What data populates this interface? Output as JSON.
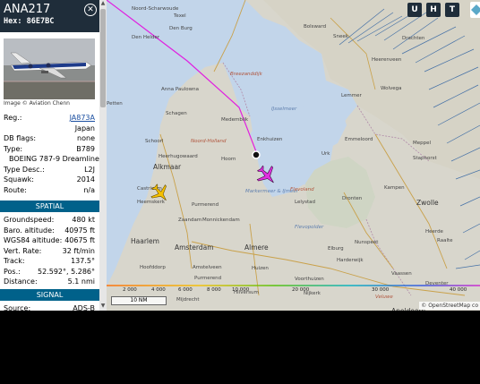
{
  "header": {
    "callsign": "ANA217",
    "hex_label": "Hex:",
    "hex": "86E7BC",
    "close_icon": "close-icon"
  },
  "photo": {
    "credit": "Image © Aviation Chenn"
  },
  "details": [
    {
      "label": "Reg.:",
      "value": "JA873A",
      "link": true
    },
    {
      "label": "",
      "value": "Japan"
    },
    {
      "label": "DB flags:",
      "value": "none"
    },
    {
      "label": "Type:",
      "value": "B789"
    },
    {
      "label": "",
      "value": "BOEING 787-9 Dreamliner",
      "wide": true
    },
    {
      "label": "Type Desc.:",
      "value": "L2J"
    },
    {
      "label": "Squawk:",
      "value": "2014"
    },
    {
      "label": "Route:",
      "value": "n/a"
    }
  ],
  "sections": {
    "spatial": "SPATIAL",
    "signal": "SIGNAL"
  },
  "spatial": [
    {
      "label": "Groundspeed:",
      "value": "480 kt"
    },
    {
      "label": "Baro. altitude:",
      "value": "40975 ft"
    },
    {
      "label": "WGS84 altitude:",
      "value": "40675 ft"
    },
    {
      "label": "Vert. Rate:",
      "value": "32 ft/min"
    },
    {
      "label": "Track:",
      "value": "137.5°"
    },
    {
      "label": "Pos.:",
      "value": "52.592°, 5.286°"
    },
    {
      "label": "Distance:",
      "value": "5.1 nmi"
    }
  ],
  "signal": [
    {
      "label": "Source:",
      "value": "ADS-B"
    }
  ],
  "map": {
    "buttons": [
      "U",
      "H",
      "T"
    ],
    "scale": "10 NM",
    "attribution": "© OpenStreetMap co",
    "altitude_ticks": [
      "2 000",
      "4 000",
      "6 000",
      "8 000",
      "10 000",
      "20 000",
      "30 000",
      "40 000"
    ],
    "places": [
      {
        "name": "Noord-Scharwoude",
        "cls": ""
      },
      {
        "name": "Texel",
        "cls": ""
      },
      {
        "name": "Den Burg",
        "cls": ""
      },
      {
        "name": "Bolsward",
        "cls": ""
      },
      {
        "name": "Sneek",
        "cls": ""
      },
      {
        "name": "Heerenveen",
        "cls": ""
      },
      {
        "name": "Wolvega",
        "cls": ""
      },
      {
        "name": "Lemmer",
        "cls": ""
      },
      {
        "name": "Den Helder",
        "cls": ""
      },
      {
        "name": "Anna Paulowna",
        "cls": ""
      },
      {
        "name": "Schagen",
        "cls": ""
      },
      {
        "name": "Medemblik",
        "cls": ""
      },
      {
        "name": "Breezanddijk",
        "cls": "region"
      },
      {
        "name": "IJsselmeer",
        "cls": "water"
      },
      {
        "name": "Petten",
        "cls": ""
      },
      {
        "name": "Schoorl",
        "cls": ""
      },
      {
        "name": "Noord-Holland",
        "cls": "region"
      },
      {
        "name": "Enkhuizen",
        "cls": ""
      },
      {
        "name": "Emmeloord",
        "cls": ""
      },
      {
        "name": "Meppel",
        "cls": ""
      },
      {
        "name": "Staphorst",
        "cls": ""
      },
      {
        "name": "Heerhugowaard",
        "cls": ""
      },
      {
        "name": "Hoorn",
        "cls": ""
      },
      {
        "name": "Urk",
        "cls": ""
      },
      {
        "name": "Alkmaar",
        "cls": "big"
      },
      {
        "name": "Castricum",
        "cls": ""
      },
      {
        "name": "Heemskerk",
        "cls": ""
      },
      {
        "name": "Markermeer & IJmeer",
        "cls": "water"
      },
      {
        "name": "Lelystad",
        "cls": ""
      },
      {
        "name": "Flevoland",
        "cls": "region"
      },
      {
        "name": "Dronten",
        "cls": ""
      },
      {
        "name": "Kampen",
        "cls": ""
      },
      {
        "name": "Zwolle",
        "cls": "big"
      },
      {
        "name": "Purmerend",
        "cls": ""
      },
      {
        "name": "Zaandam",
        "cls": ""
      },
      {
        "name": "Monnickendam",
        "cls": ""
      },
      {
        "name": "Flevopolder",
        "cls": "water"
      },
      {
        "name": "Heerde",
        "cls": ""
      },
      {
        "name": "Raalte",
        "cls": ""
      },
      {
        "name": "Haarlem",
        "cls": "big"
      },
      {
        "name": "Amsterdam",
        "cls": "big"
      },
      {
        "name": "Almere",
        "cls": "big"
      },
      {
        "name": "Nunspeet",
        "cls": ""
      },
      {
        "name": "Elburg",
        "cls": ""
      },
      {
        "name": "Hoofddorp",
        "cls": ""
      },
      {
        "name": "Amstelveen",
        "cls": ""
      },
      {
        "name": "Huizen",
        "cls": ""
      },
      {
        "name": "Harderwijk",
        "cls": ""
      },
      {
        "name": "Vaassen",
        "cls": ""
      },
      {
        "name": "Purmerend",
        "cls": ""
      },
      {
        "name": "Hilversum",
        "cls": ""
      },
      {
        "name": "Nijkerk",
        "cls": ""
      },
      {
        "name": "Veluwe",
        "cls": "region"
      },
      {
        "name": "Apeldoorn",
        "cls": "big"
      },
      {
        "name": "Deventer",
        "cls": ""
      },
      {
        "name": "Mijdrecht",
        "cls": ""
      },
      {
        "name": "Voorthuizen",
        "cls": ""
      },
      {
        "name": "Drachten",
        "cls": ""
      }
    ]
  },
  "colors": {
    "header": "#1f2d3a",
    "section": "#00618a",
    "track": "#e020e0",
    "selected_plane": "#e030e0",
    "other_plane": "#f5c000",
    "water": "#c2d5ea",
    "land": "#d8d6cc"
  }
}
